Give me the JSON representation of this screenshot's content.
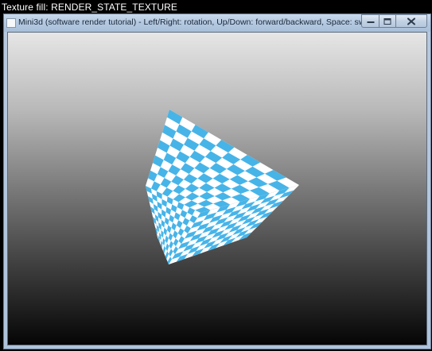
{
  "caption": {
    "text": "Texture fill: RENDER_STATE_TEXTURE"
  },
  "window": {
    "title": "Mini3d (software render tutorial) - Left/Right: rotation, Up/Down: forward/backward, Space: switch state"
  },
  "scene": {
    "object": "cube",
    "texture": "checkerboard",
    "colors": {
      "texture_primary": "#47b4e8",
      "texture_secondary": "#ffffff",
      "background_top": "#e6e6e6",
      "background_bottom": "#050505"
    }
  }
}
